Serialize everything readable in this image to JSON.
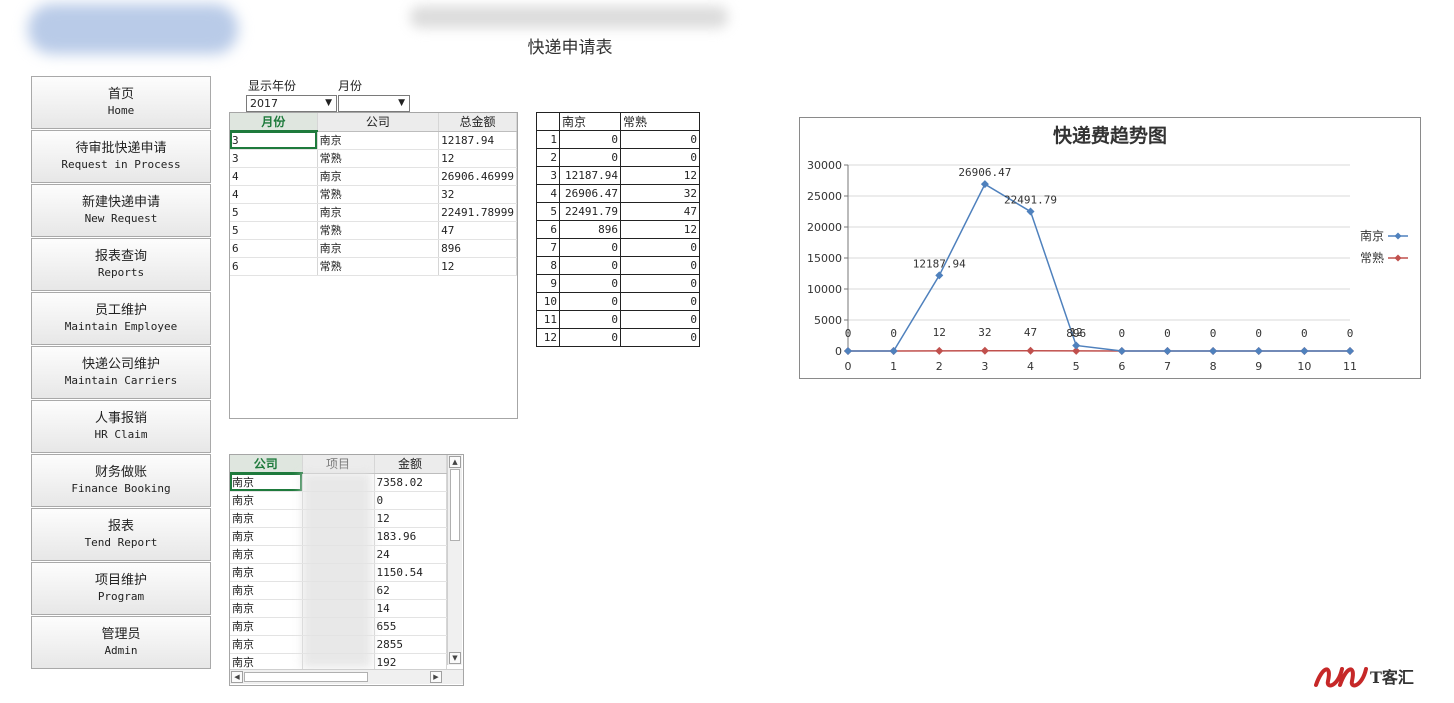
{
  "header": {
    "title": "快递申请表"
  },
  "nav": [
    {
      "cn": "首页",
      "en": "Home"
    },
    {
      "cn": "待审批快递申请",
      "en": "Request in Process"
    },
    {
      "cn": "新建快递申请",
      "en": "New Request"
    },
    {
      "cn": "报表查询",
      "en": "Reports"
    },
    {
      "cn": "员工维护",
      "en": "Maintain Employee"
    },
    {
      "cn": "快递公司维护",
      "en": "Maintain Carriers"
    },
    {
      "cn": "人事报销",
      "en": "HR Claim"
    },
    {
      "cn": "财务做账",
      "en": "Finance Booking"
    },
    {
      "cn": "报表",
      "en": "Tend Report"
    },
    {
      "cn": "项目维护",
      "en": "Program"
    },
    {
      "cn": "管理员",
      "en": "Admin"
    }
  ],
  "filters": {
    "year_label": "显示年份",
    "month_label": "月份",
    "year_value": "2017",
    "month_value": ""
  },
  "summary_grid": {
    "headers": [
      "月份",
      "公司",
      "总金额"
    ],
    "rows": [
      [
        "3",
        "南京",
        "12187.94"
      ],
      [
        "3",
        "常熟",
        "12"
      ],
      [
        "4",
        "南京",
        "26906.46999"
      ],
      [
        "4",
        "常熟",
        "32"
      ],
      [
        "5",
        "南京",
        "22491.78999"
      ],
      [
        "5",
        "常熟",
        "47"
      ],
      [
        "6",
        "南京",
        "896"
      ],
      [
        "6",
        "常熟",
        "12"
      ]
    ]
  },
  "pivot": {
    "headers": [
      "",
      "南京",
      "常熟"
    ],
    "rows": [
      [
        "1",
        "0",
        "0"
      ],
      [
        "2",
        "0",
        "0"
      ],
      [
        "3",
        "12187.94",
        "12"
      ],
      [
        "4",
        "26906.47",
        "32"
      ],
      [
        "5",
        "22491.79",
        "47"
      ],
      [
        "6",
        "896",
        "12"
      ],
      [
        "7",
        "0",
        "0"
      ],
      [
        "8",
        "0",
        "0"
      ],
      [
        "9",
        "0",
        "0"
      ],
      [
        "10",
        "0",
        "0"
      ],
      [
        "11",
        "0",
        "0"
      ],
      [
        "12",
        "0",
        "0"
      ]
    ]
  },
  "detail_grid": {
    "headers": [
      "公司",
      "项目",
      "金额"
    ],
    "rows": [
      [
        "南京",
        "",
        "7358.02"
      ],
      [
        "南京",
        "",
        "0"
      ],
      [
        "南京",
        "",
        "12"
      ],
      [
        "南京",
        "",
        "183.96"
      ],
      [
        "南京",
        "",
        "24"
      ],
      [
        "南京",
        "",
        "1150.54"
      ],
      [
        "南京",
        "",
        "62"
      ],
      [
        "南京",
        "",
        "14"
      ],
      [
        "南京",
        "",
        "655"
      ],
      [
        "南京",
        "",
        "2855"
      ],
      [
        "南京",
        "",
        "192"
      ]
    ]
  },
  "chart_data": {
    "type": "line",
    "title": "快递费趋势图",
    "x": [
      0,
      1,
      2,
      3,
      4,
      5,
      6,
      7,
      8,
      9,
      10,
      11
    ],
    "ylim": [
      0,
      30000
    ],
    "yticks": [
      0,
      5000,
      10000,
      15000,
      20000,
      25000,
      30000
    ],
    "grid": true,
    "legend_position": "right",
    "series": [
      {
        "name": "南京",
        "color": "#4f81bd",
        "values": [
          0,
          0,
          12187.94,
          26906.47,
          22491.79,
          896,
          0,
          0,
          0,
          0,
          0,
          0
        ],
        "labels": [
          "0",
          "0",
          "12187.94",
          "26906.47",
          "22491.79",
          "896",
          "0",
          "0",
          "0",
          "0",
          "0",
          "0"
        ]
      },
      {
        "name": "常熟",
        "color": "#c0504d",
        "values": [
          0,
          0,
          12,
          32,
          47,
          12,
          0,
          0,
          0,
          0,
          0,
          0
        ],
        "labels": [
          "",
          "",
          "12",
          "32",
          "47",
          "12",
          "",
          "",
          "",
          "",
          "",
          ""
        ]
      }
    ]
  },
  "watermark": {
    "text": "T客汇"
  }
}
